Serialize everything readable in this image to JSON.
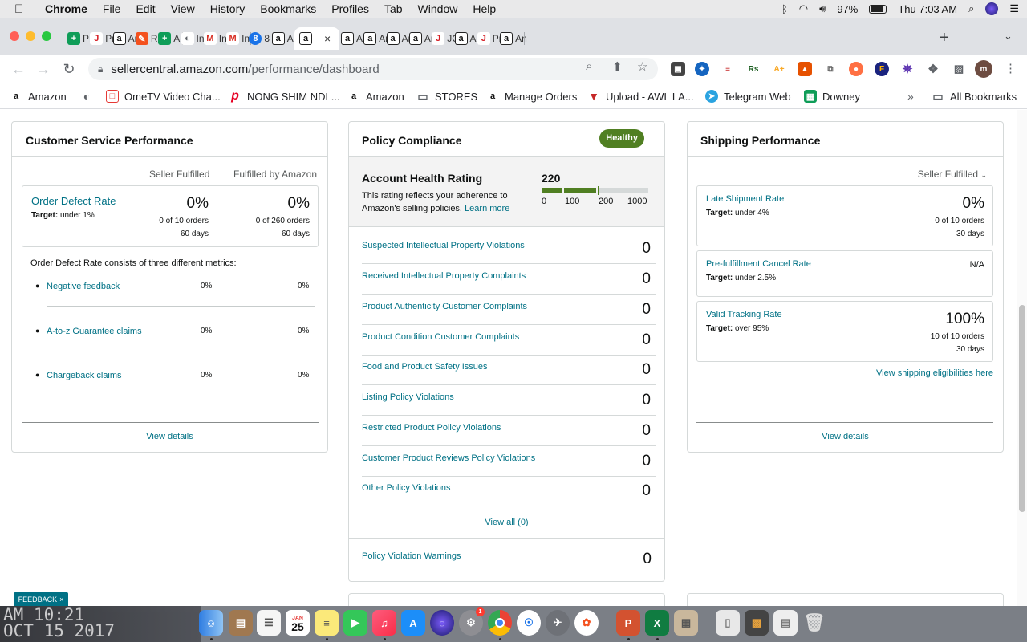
{
  "menubar": {
    "app": "Chrome",
    "items": [
      "File",
      "Edit",
      "View",
      "History",
      "Bookmarks",
      "Profiles",
      "Tab",
      "Window",
      "Help"
    ],
    "battery": "97%",
    "clock": "Thu 7:03 AM"
  },
  "tabs": [
    {
      "label": "PR",
      "icon": "sheets-icon",
      "color": "#0f9d58"
    },
    {
      "label": "Pro",
      "icon": "jt-icon",
      "color": "#d61f26"
    },
    {
      "label": "Am",
      "icon": "amazon-icon",
      "color": "#ffffff"
    },
    {
      "label": "RE",
      "icon": "pen-icon",
      "color": "#f4511e"
    },
    {
      "label": "Aut",
      "icon": "sheets-icon",
      "color": "#0f9d58"
    },
    {
      "label": "Inv",
      "icon": "globe-icon",
      "color": "#5f6368"
    },
    {
      "label": "Inb",
      "icon": "gmail-icon",
      "color": "#d93025"
    },
    {
      "label": "Inb",
      "icon": "gmail-icon",
      "color": "#d93025"
    },
    {
      "label": "8 n",
      "icon": "badge-icon",
      "color": "#1a73e8"
    },
    {
      "label": "Am",
      "icon": "amazon-icon",
      "color": "#ffffff"
    },
    {
      "label": "",
      "icon": "amazon-icon",
      "color": "#ffffff",
      "active": true
    },
    {
      "label": "Am",
      "icon": "amazon-icon",
      "color": "#ffffff"
    },
    {
      "label": "Am",
      "icon": "amazon-icon",
      "color": "#ffffff"
    },
    {
      "label": "Am",
      "icon": "amazon-icon",
      "color": "#ffffff"
    },
    {
      "label": "Am",
      "icon": "amazon-icon",
      "color": "#ffffff"
    },
    {
      "label": "JC",
      "icon": "jt-icon",
      "color": "#d61f26"
    },
    {
      "label": "An",
      "icon": "amazon-icon",
      "color": "#ffffff"
    },
    {
      "label": "Pro",
      "icon": "jt-icon",
      "color": "#d61f26"
    },
    {
      "label": "An",
      "icon": "amazon-icon",
      "color": "#ffffff"
    }
  ],
  "address": {
    "host": "sellercentral.amazon.com",
    "path": "/performance/dashboard"
  },
  "bookmarks": [
    {
      "label": "Amazon",
      "icon": "amazon-icon"
    },
    {
      "label": "",
      "icon": "globe-icon"
    },
    {
      "label": "OmeTV Video Cha...",
      "icon": "ometv-icon"
    },
    {
      "label": "NONG SHIM NDL...",
      "icon": "pinterest-icon"
    },
    {
      "label": "Amazon",
      "icon": "amazon-icon"
    },
    {
      "label": "STORES",
      "icon": "folder-icon"
    },
    {
      "label": "Manage Orders",
      "icon": "amazon-icon"
    },
    {
      "label": "Upload - AWL LA...",
      "icon": "awl-icon"
    },
    {
      "label": "Telegram Web",
      "icon": "telegram-icon"
    },
    {
      "label": "Downey",
      "icon": "sheets-icon"
    },
    {
      "label": "All Bookmarks",
      "icon": "folder-icon"
    }
  ],
  "customer_service": {
    "title": "Customer Service Performance",
    "col1": "Seller Fulfilled",
    "col2": "Fulfilled by Amazon",
    "odr": {
      "name": "Order Defect Rate",
      "target_label": "Target:",
      "target": "under 1%",
      "sf_value": "0%",
      "sf_orders": "0 of 10 orders",
      "sf_days": "60 days",
      "fba_value": "0%",
      "fba_orders": "0 of 260 orders",
      "fba_days": "60 days"
    },
    "metrics_intro": "Order Defect Rate consists of three different metrics:",
    "metrics": [
      {
        "name": "Negative feedback",
        "sf": "0%",
        "fba": "0%"
      },
      {
        "name": "A-to-z Guarantee claims",
        "sf": "0%",
        "fba": "0%"
      },
      {
        "name": "Chargeback claims",
        "sf": "0%",
        "fba": "0%"
      }
    ],
    "view_details": "View details"
  },
  "policy": {
    "title": "Policy Compliance",
    "badge": "Healthy",
    "badge_color": "#507f22",
    "ahr_title": "Account Health Rating",
    "ahr_desc": "This rating reflects your adherence to Amazon's selling policies.",
    "ahr_learn": "Learn more",
    "ahr_score": "220",
    "ahr_score_value": 220,
    "scale_labels": [
      "0",
      "100",
      "200",
      "1000"
    ],
    "rows": [
      {
        "name": "Suspected Intellectual Property Violations",
        "value": "0"
      },
      {
        "name": "Received Intellectual Property Complaints",
        "value": "0"
      },
      {
        "name": "Product Authenticity Customer Complaints",
        "value": "0"
      },
      {
        "name": "Product Condition Customer Complaints",
        "value": "0"
      },
      {
        "name": "Food and Product Safety Issues",
        "value": "0"
      },
      {
        "name": "Listing Policy Violations",
        "value": "0"
      },
      {
        "name": "Restricted Product Policy Violations",
        "value": "0"
      },
      {
        "name": "Customer Product Reviews Policy Violations",
        "value": "0"
      },
      {
        "name": "Other Policy Violations",
        "value": "0"
      }
    ],
    "view_all": "View all (0)",
    "warnings": {
      "name": "Policy Violation Warnings",
      "value": "0"
    }
  },
  "shipping": {
    "title": "Shipping Performance",
    "selector": "Seller Fulfilled",
    "metrics": [
      {
        "name": "Late Shipment Rate",
        "target_label": "Target:",
        "target": "under 4%",
        "value": "0%",
        "orders": "0 of 10 orders",
        "days": "30 days"
      },
      {
        "name": "Pre-fulfillment Cancel Rate",
        "target_label": "Target:",
        "target": "under 2.5%",
        "value": "N/A",
        "orders": "",
        "days": ""
      },
      {
        "name": "Valid Tracking Rate",
        "target_label": "Target:",
        "target": "over 95%",
        "value": "100%",
        "orders": "10 of 10 orders",
        "days": "30 days"
      }
    ],
    "eligibilities": "View shipping eligibilities here",
    "view_details": "View details"
  },
  "feedback": "FEEDBACK",
  "wallpaper_text": [
    "AM 10:21",
    "OCT 15 2017"
  ],
  "dock": {
    "calendar_month": "JAN",
    "calendar_day": "25",
    "settings_badge": "1",
    "excel_letter": "X",
    "powerpoint_letter": "P"
  }
}
